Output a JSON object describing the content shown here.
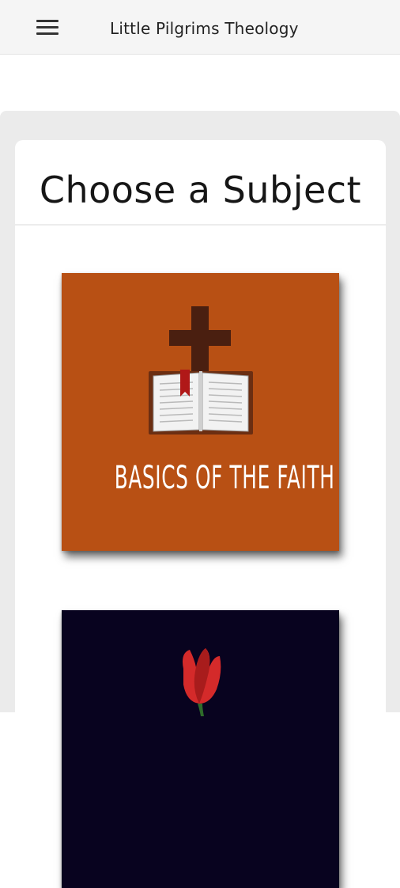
{
  "app": {
    "title": "Little Pilgrims Theology",
    "menu_icon": "hamburger-menu-icon"
  },
  "page": {
    "heading": "Choose a Subject"
  },
  "subjects": [
    {
      "label": "BASICS OF THE FAITH",
      "background": "#b85014",
      "icon": "cross-and-open-bible-icon"
    },
    {
      "label": "",
      "background": "#08031f",
      "icon": "red-tulip-icon"
    }
  ],
  "colors": {
    "appbar_bg": "#f5f5f5",
    "panel_bg": "#ebebeb",
    "card_bg": "#ffffff"
  }
}
